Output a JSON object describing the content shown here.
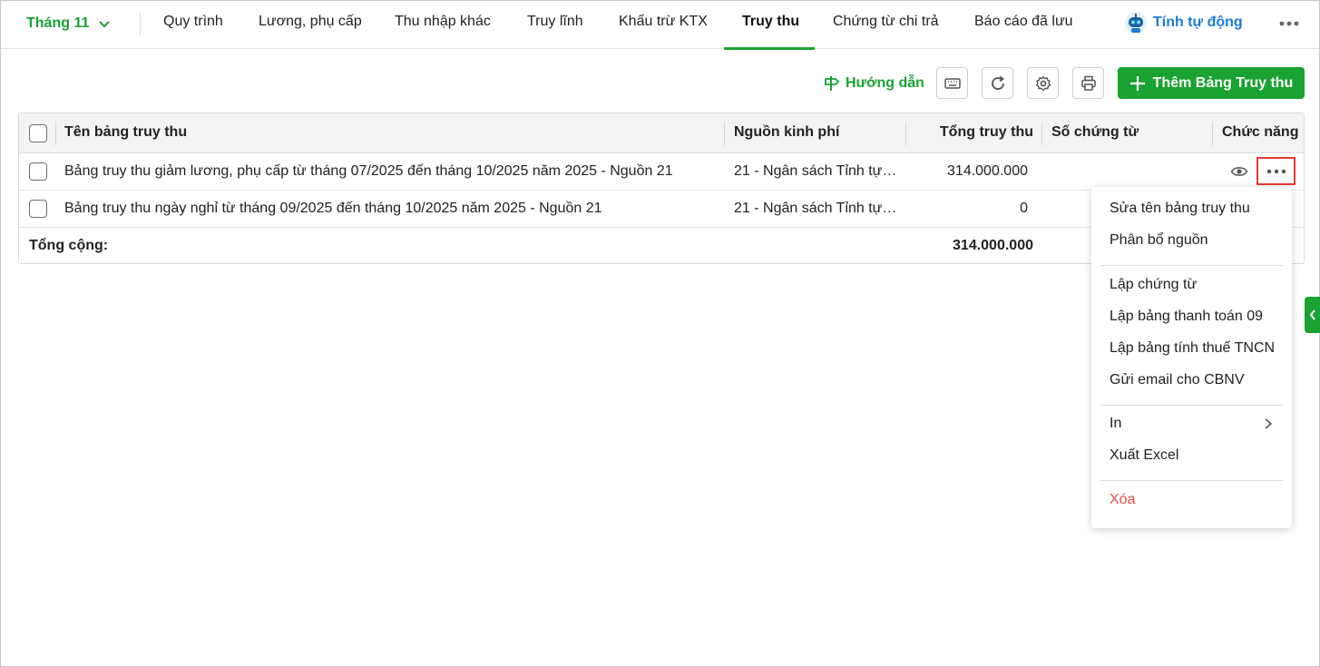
{
  "nav": {
    "month": "Tháng 11",
    "tabs": [
      {
        "label": "Quy trình"
      },
      {
        "label": "Lương, phụ cấp"
      },
      {
        "label": "Thu nhập khác"
      },
      {
        "label": "Truy lĩnh"
      },
      {
        "label": "Khấu trừ KTX"
      },
      {
        "label": "Truy thu"
      },
      {
        "label": "Chứng từ chi trả"
      },
      {
        "label": "Báo cáo đã lưu"
      }
    ],
    "active_tab": "Truy thu",
    "auto_label": "Tính tự động"
  },
  "toolbar": {
    "guide_label": "Hướng dẫn",
    "add_label": "Thêm Bảng Truy thu"
  },
  "table": {
    "headers": {
      "name": "Tên bảng truy thu",
      "source": "Nguồn kinh phí",
      "total": "Tổng truy thu",
      "voucher": "Số chứng từ",
      "actions": "Chức năng"
    },
    "rows": [
      {
        "name": "Bảng truy thu giảm lương, phụ cấp từ tháng 07/2025 đến tháng 10/2025 năm 2025 - Nguồn 21",
        "source": "21 - Ngân sách Tỉnh tự ...",
        "total": "314.000.000",
        "voucher": ""
      },
      {
        "name": "Bảng truy thu ngày nghỉ từ tháng 09/2025 đến tháng 10/2025 năm 2025 - Nguồn 21",
        "source": "21 - Ngân sách Tỉnh tự ...",
        "total": "0",
        "voucher": ""
      }
    ],
    "footer": {
      "label": "Tổng cộng:",
      "total": "314.000.000"
    }
  },
  "context_menu": {
    "items": [
      {
        "label": "Sửa tên bảng truy thu"
      },
      {
        "label": "Phân bổ nguồn"
      },
      {
        "label": "Lập chứng từ"
      },
      {
        "label": "Lập bảng thanh toán 09"
      },
      {
        "label": "Lập bảng tính thuế TNCN"
      },
      {
        "label": "Gửi email cho CBNV"
      },
      {
        "label": "In"
      },
      {
        "label": "Xuất Excel"
      },
      {
        "label": "Xóa"
      }
    ]
  },
  "colors": {
    "accent": "#1aa232",
    "auto_blue": "#1b7bd6",
    "danger": "#e84a4a",
    "highlight_border": "#e53935"
  }
}
